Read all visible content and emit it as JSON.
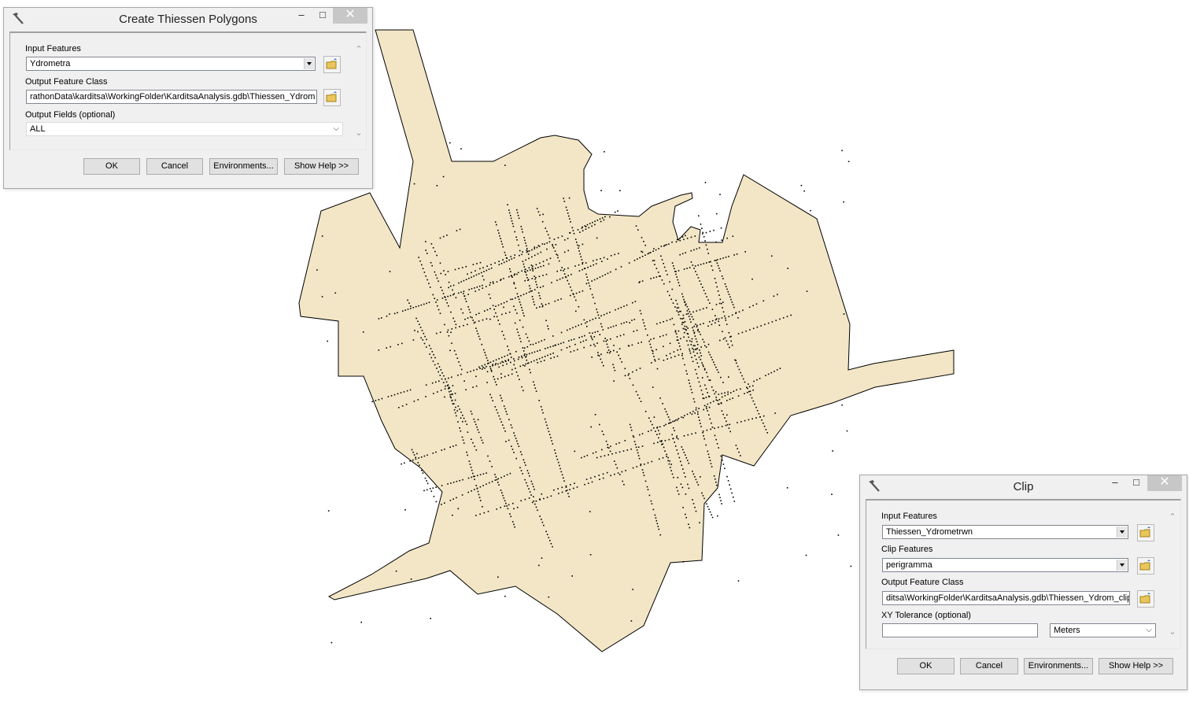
{
  "map": {
    "polygon_fill": "#f2e6c6",
    "outline": "#000000",
    "point_color": "#000000"
  },
  "thiessen_dialog": {
    "title": "Create Thiessen Polygons",
    "input_features_label": "Input Features",
    "input_features_value": "Ydrometra",
    "output_class_label": "Output Feature Class",
    "output_class_value": "rathonData\\karditsa\\WorkingFolder\\KarditsaAnalysis.gdb\\Thiessen_Ydrom",
    "output_fields_label": "Output Fields (optional)",
    "output_fields_value": "ALL",
    "ok": "OK",
    "cancel": "Cancel",
    "environments": "Environments...",
    "show_help": "Show Help >>"
  },
  "clip_dialog": {
    "title": "Clip",
    "input_features_label": "Input Features",
    "input_features_value": "Thiessen_Ydrometrwn",
    "clip_features_label": "Clip Features",
    "clip_features_value": "perigramma",
    "output_class_label": "Output Feature Class",
    "output_class_value": "ditsa\\WorkingFolder\\KarditsaAnalysis.gdb\\Thiessen_Ydrom_clip",
    "xy_tolerance_label": "XY Tolerance (optional)",
    "xy_tolerance_value": "",
    "units_value": "Meters",
    "ok": "OK",
    "cancel": "Cancel",
    "environments": "Environments...",
    "show_help": "Show Help >>"
  },
  "window_buttons": {
    "minimize": "–",
    "maximize": "□",
    "close": "✕"
  }
}
